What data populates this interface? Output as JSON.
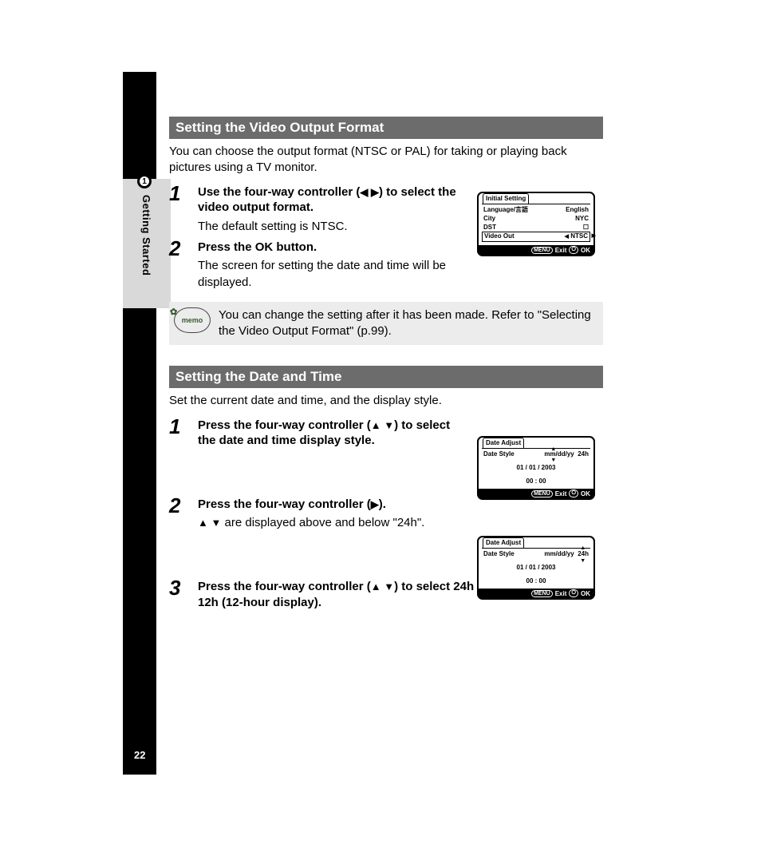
{
  "sidebar": {
    "chapter_number": "1",
    "chapter_title": "Getting Started"
  },
  "page_number": "22",
  "section1": {
    "title": "Setting the Video Output Format",
    "intro": "You can choose the output format (NTSC or PAL) for taking or playing back pictures using a TV monitor.",
    "step1": {
      "num": "1",
      "title_a": "Use the four-way controller (",
      "title_b": ") to select the video output format.",
      "desc": "The default setting is NTSC."
    },
    "step2": {
      "num": "2",
      "title": "Press the OK button.",
      "desc": "The screen for setting the date and time will be displayed."
    },
    "memo": "You can change the setting after it has been made. Refer to \"Selecting the Video Output Format\" (p.99)."
  },
  "section2": {
    "title": "Setting the Date and Time",
    "intro": "Set the current date and time, and the display style.",
    "step1": {
      "num": "1",
      "title_a": "Press the four-way controller (",
      "title_b": ") to select the date and time display style."
    },
    "step2": {
      "num": "2",
      "title_a": "Press the four-way controller (",
      "title_b": ").",
      "desc_a": " are displayed above and below \"24h\"."
    },
    "step3": {
      "num": "3",
      "title_a": "Press the four-way controller (",
      "title_b": ") to select 24h (24-hour display) or 12h (12-hour display)."
    }
  },
  "lcd1": {
    "tab": "Initial Setting",
    "row1_l": "Language/言語",
    "row1_r": "English",
    "row2_l": "City",
    "row2_r": "NYC",
    "row3_l": "DST",
    "row4_l": "Video Out",
    "row4_r": "NTSC",
    "foot_menu": "MENU",
    "foot_exit": "Exit",
    "foot_ok": "OK"
  },
  "lcd2": {
    "tab": "Date Adjust",
    "row1_l": "Date Style",
    "row1_r": "mm/dd/yy",
    "row1_r2": "24h",
    "row2": "01 / 01 / 2003",
    "row3": "00 : 00",
    "foot_menu": "MENU",
    "foot_exit": "Exit",
    "foot_ok": "OK"
  },
  "lcd3": {
    "tab": "Date Adjust",
    "row1_l": "Date Style",
    "row1_r": "mm/dd/yy",
    "row1_r2": "24h",
    "row2": "01 / 01 / 2003",
    "row3": "00 : 00",
    "foot_menu": "MENU",
    "foot_exit": "Exit",
    "foot_ok": "OK"
  },
  "memo_label": "memo"
}
